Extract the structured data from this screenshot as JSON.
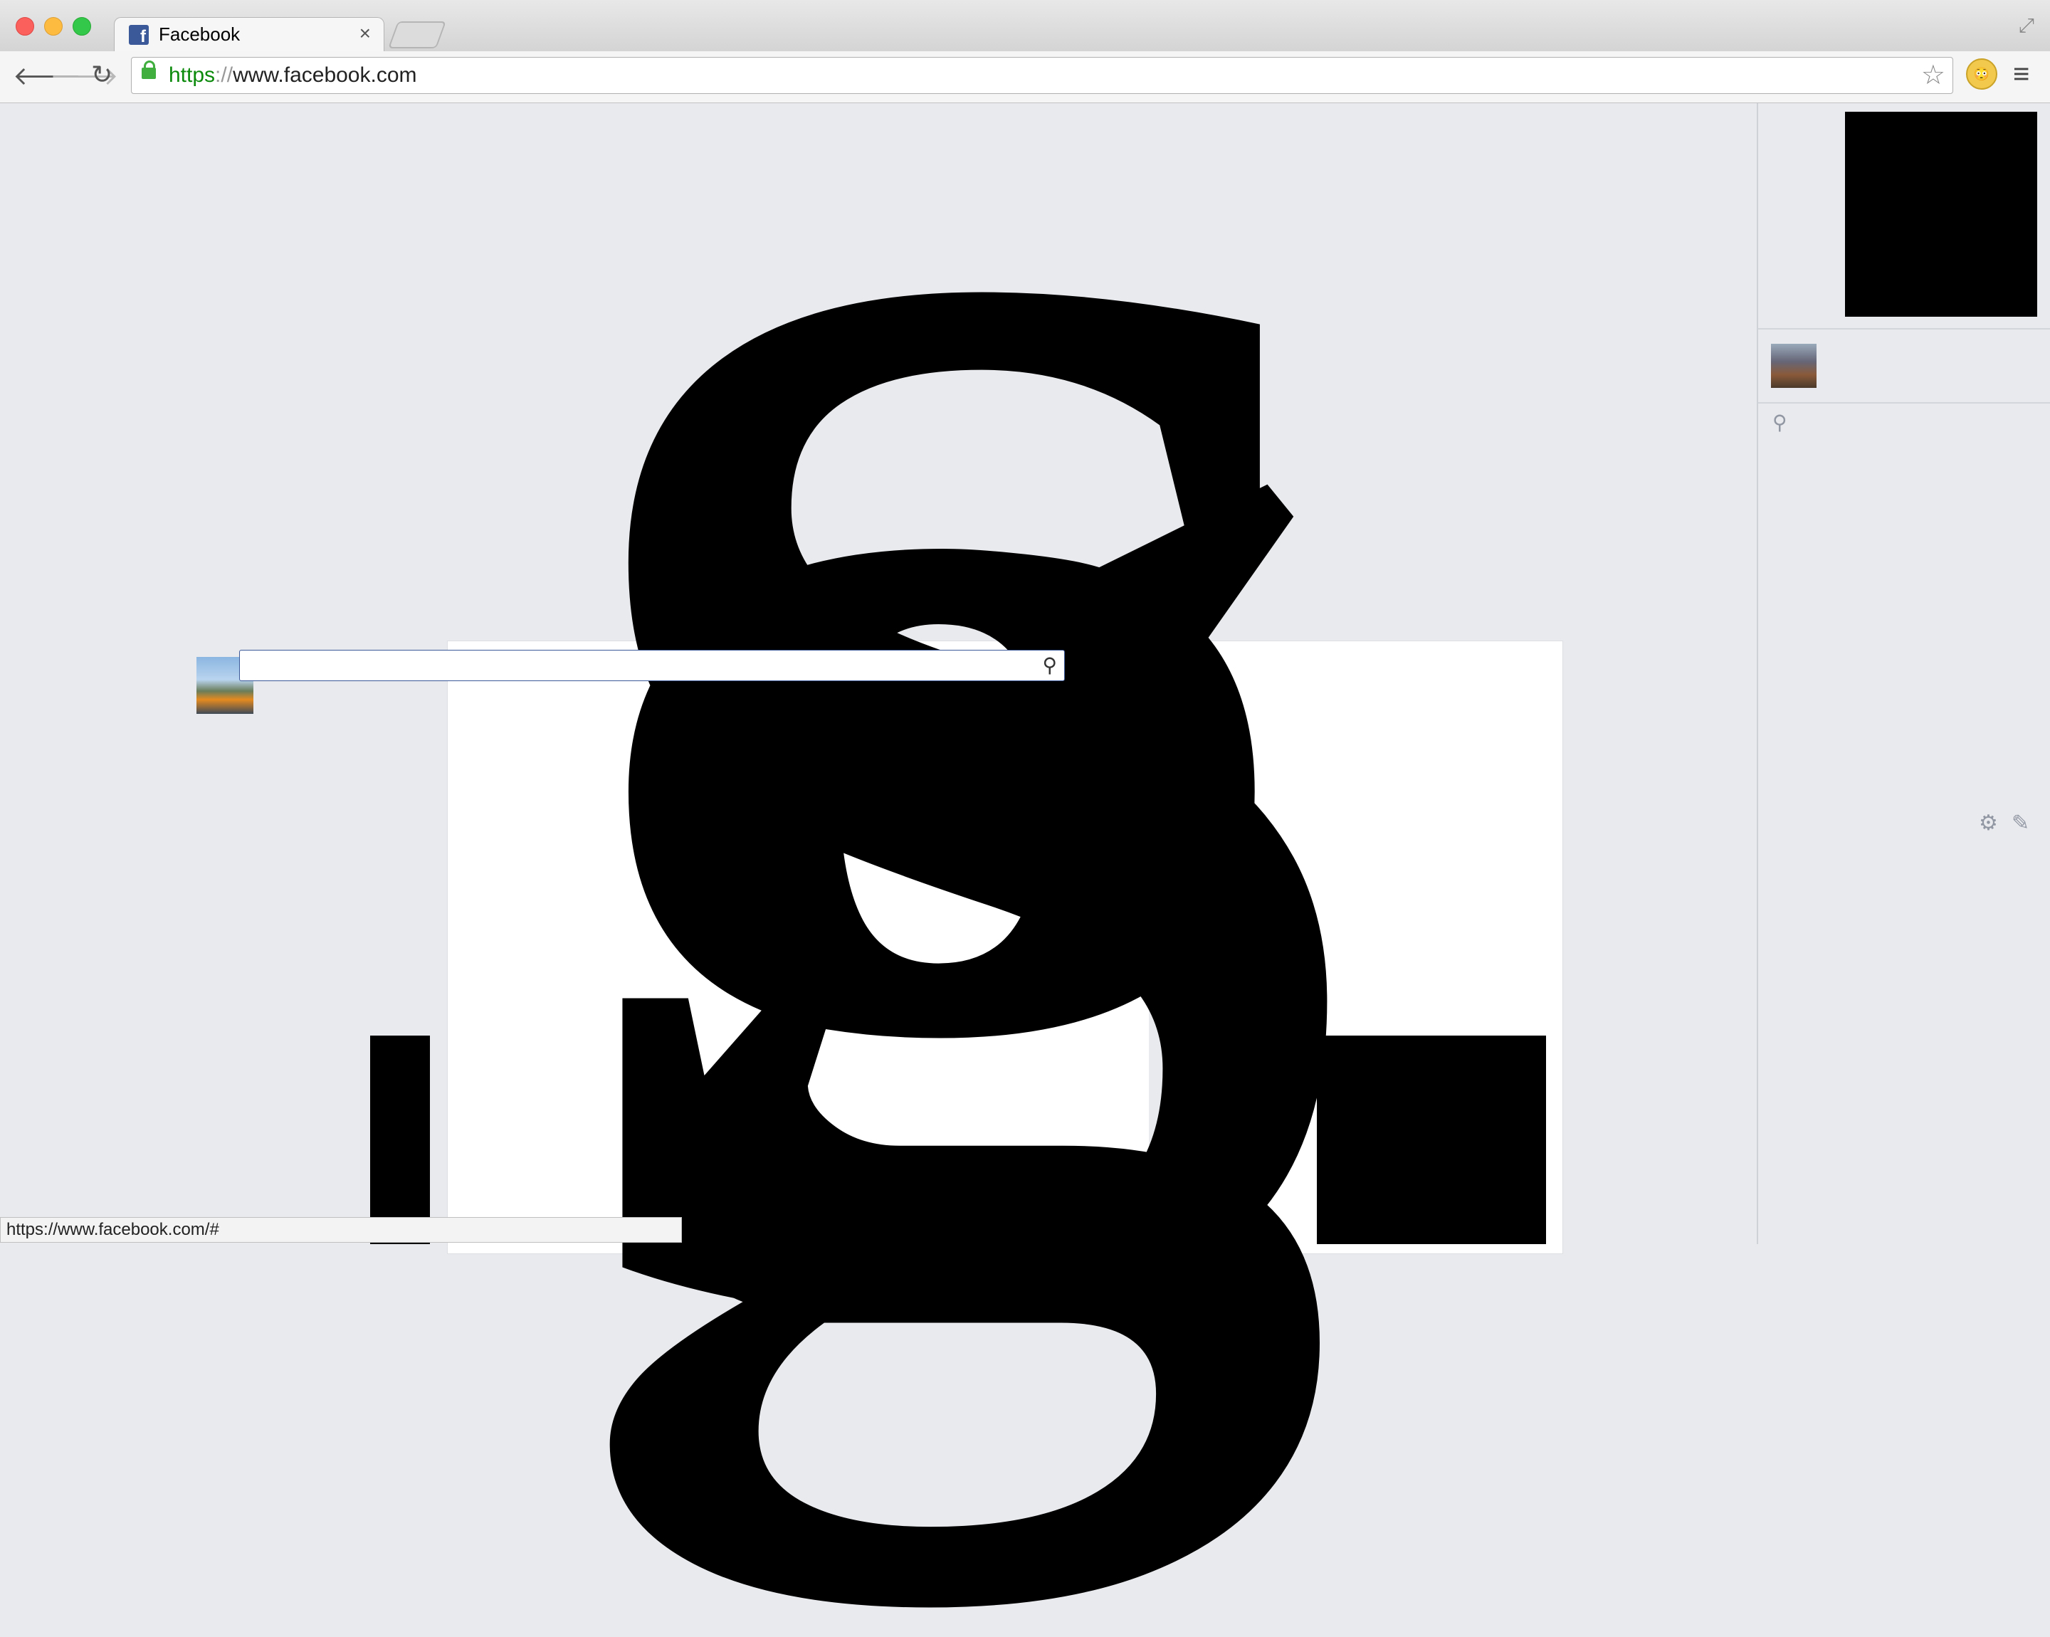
{
  "browser": {
    "tab_title": "Facebook",
    "tab_close": "×",
    "favicon_letter": "f",
    "url_scheme": "https",
    "url_separator": "://",
    "url_host": "www.facebook.com",
    "status_url": "https://www.facebook.com/#"
  },
  "icons": {
    "back": "🡐",
    "forward": "🡒",
    "reload": "↻",
    "star": "☆",
    "menu": "≡",
    "fullscreen": "⤢",
    "search": "⚲",
    "gear": "⚙",
    "compose": "✎",
    "extension": "😳"
  },
  "page": {
    "glyph_g": "g",
    "glyph_s": "S",
    "search_value": ""
  },
  "colors": {
    "page_bg": "#e9eaed",
    "brand": "#3b5998",
    "secure_green": "#0b8a0b"
  }
}
